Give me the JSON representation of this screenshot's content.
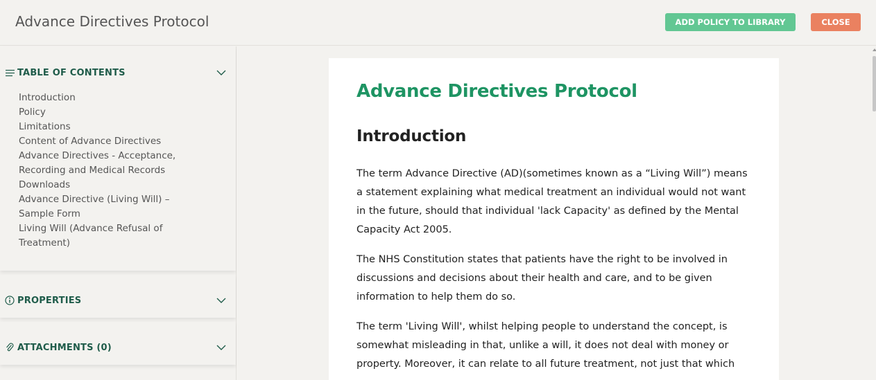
{
  "header": {
    "title": "Advance Directives Protocol",
    "add_button": "ADD POLICY TO LIBRARY",
    "close_button": "CLOSE"
  },
  "colors": {
    "accent_green": "#62c793",
    "close_orange": "#ea8160",
    "heading_green": "#1e9463",
    "sidebar_heading": "#1f5c4a"
  },
  "sidebar": {
    "toc": {
      "label": "TABLE OF CONTENTS",
      "icon": "list-icon",
      "items": [
        "Introduction",
        "Policy",
        "Limitations",
        "Content of Advance Directives",
        "Advance Directives - Acceptance,",
        "Recording and Medical Records",
        "Downloads",
        "Advance Directive (Living Will) –",
        "Sample Form",
        "Living Will (Advance Refusal of",
        "Treatment)"
      ]
    },
    "properties": {
      "label": "PROPERTIES",
      "icon": "info-icon"
    },
    "attachments": {
      "label": "ATTACHMENTS (0)",
      "icon": "paperclip-icon"
    }
  },
  "document": {
    "title": "Advance Directives Protocol",
    "section_heading": "Introduction",
    "paragraphs": [
      "The term Advance Directive (AD)(sometimes known as a “Living Will”) means a statement explaining what medical treatment an individual would not want in the future, should that individual 'lack Capacity' as defined by the Mental Capacity Act 2005.",
      "The NHS Constitution states that patients have the right to be involved in discussions and decisions about their health and care, and to be given information to help them do so.",
      "The term 'Living Will', whilst helping people to understand the concept, is somewhat misleading in that, unlike a will, it does not deal with money or property. Moreover, it can relate to all future treatment, not just that which"
    ]
  }
}
